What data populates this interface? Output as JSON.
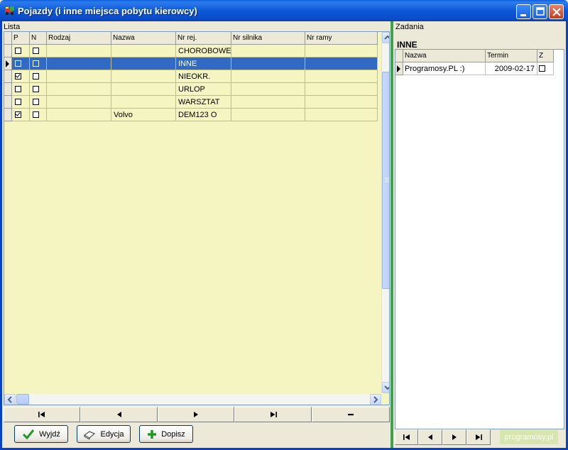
{
  "window": {
    "title": "Pojazdy (i inne miejsca pobytu kierowcy)",
    "controls": [
      "minimize-icon",
      "maximize-icon",
      "close-icon"
    ]
  },
  "lista": {
    "label": "Lista",
    "columns": [
      "P",
      "N",
      "Rodzaj",
      "Nazwa",
      "Nr rej.",
      "Nr silnika",
      "Nr ramy"
    ],
    "rows": [
      {
        "p": false,
        "n": false,
        "rodzaj": "",
        "nazwa": "",
        "nr_rej": "CHOROBOWE",
        "nr_silnika": "",
        "nr_ramy": "",
        "selected": false
      },
      {
        "p": false,
        "n": false,
        "rodzaj": "",
        "nazwa": "",
        "nr_rej": "INNE",
        "nr_silnika": "",
        "nr_ramy": "",
        "selected": true
      },
      {
        "p": true,
        "n": false,
        "rodzaj": "",
        "nazwa": "",
        "nr_rej": "NIEOKR.",
        "nr_silnika": "",
        "nr_ramy": "",
        "selected": false
      },
      {
        "p": false,
        "n": false,
        "rodzaj": "",
        "nazwa": "",
        "nr_rej": "URLOP",
        "nr_silnika": "",
        "nr_ramy": "",
        "selected": false
      },
      {
        "p": false,
        "n": false,
        "rodzaj": "",
        "nazwa": "",
        "nr_rej": "WARSZTAT",
        "nr_silnika": "",
        "nr_ramy": "",
        "selected": false
      },
      {
        "p": true,
        "n": false,
        "rodzaj": "",
        "nazwa": "Volvo",
        "nr_rej": "DEM123 O",
        "nr_silnika": "",
        "nr_ramy": "",
        "selected": false
      }
    ]
  },
  "navigator": {
    "buttons": [
      "first-icon",
      "prior-icon",
      "next-icon",
      "last-icon",
      "delete-icon"
    ]
  },
  "actions": {
    "wyjdz": "Wyjdź",
    "edycja": "Edycja",
    "dopisz": "Dopisz"
  },
  "zadania": {
    "label": "Zadania",
    "current": "INNE",
    "columns": [
      "Nazwa",
      "Termin",
      "Z"
    ],
    "rows": [
      {
        "nazwa": "Programosy.PL :)",
        "termin": "2009-02-17",
        "z": false
      }
    ]
  },
  "navigator2": {
    "buttons": [
      "first-icon",
      "prior-icon",
      "next-icon",
      "last-icon"
    ]
  },
  "watermark": "programosy.pl",
  "colors": {
    "title_bar": "#0A5FDA",
    "grid_background": "#F5F5C2",
    "selected_row": "#316AC5",
    "divider": "#3FA34D"
  }
}
